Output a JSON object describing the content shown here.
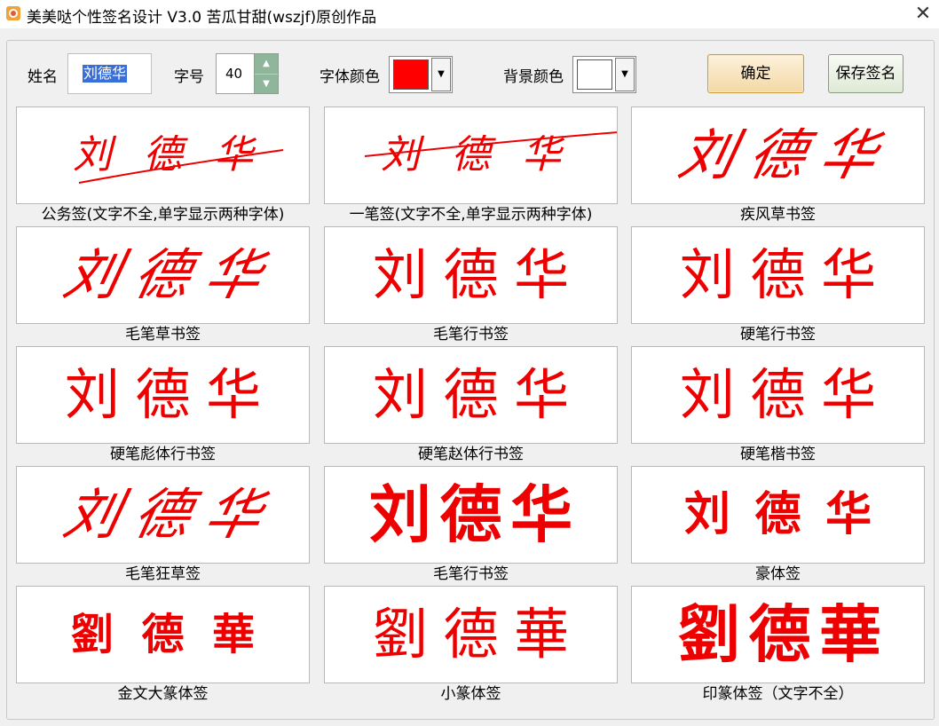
{
  "window": {
    "title": "美美哒个性签名设计 V3.0   苦瓜甘甜(wszjf)原创作品",
    "close_glyph": "✕"
  },
  "toolbar": {
    "name_label": "姓名",
    "name_value": "刘德华",
    "size_label": "字号",
    "size_value": "40",
    "font_color_label": "字体颜色",
    "font_color": "#ff0000",
    "bg_color_label": "背景颜色",
    "bg_color": "#ffffff",
    "confirm_label": "确定",
    "save_label": "保存签名"
  },
  "signatures": [
    {
      "caption": "公务签(文字不全,单字显示两种字体)",
      "text": "刘德华"
    },
    {
      "caption": "一笔签(文字不全,单字显示两种字体)",
      "text": "刘德华"
    },
    {
      "caption": "疾风草书签",
      "text": "刘德华"
    },
    {
      "caption": "毛笔草书签",
      "text": "刘德华"
    },
    {
      "caption": "毛笔行书签",
      "text": "刘德华"
    },
    {
      "caption": "硬笔行书签",
      "text": "刘德华"
    },
    {
      "caption": "硬笔彪体行书签",
      "text": "刘德华"
    },
    {
      "caption": "硬笔赵体行书签",
      "text": "刘德华"
    },
    {
      "caption": "硬笔楷书签",
      "text": "刘德华"
    },
    {
      "caption": "毛笔狂草签",
      "text": "刘德华"
    },
    {
      "caption": "毛笔行书签",
      "text": "刘德华"
    },
    {
      "caption": "豪体签",
      "text": "刘德华"
    },
    {
      "caption": "金文大篆体签",
      "text": "劉德華"
    },
    {
      "caption": "小篆体签",
      "text": "劉德華"
    },
    {
      "caption": "印篆体签（文字不全）",
      "text": "劉德華"
    }
  ],
  "colors": {
    "signature_ink": "#ee0000"
  }
}
